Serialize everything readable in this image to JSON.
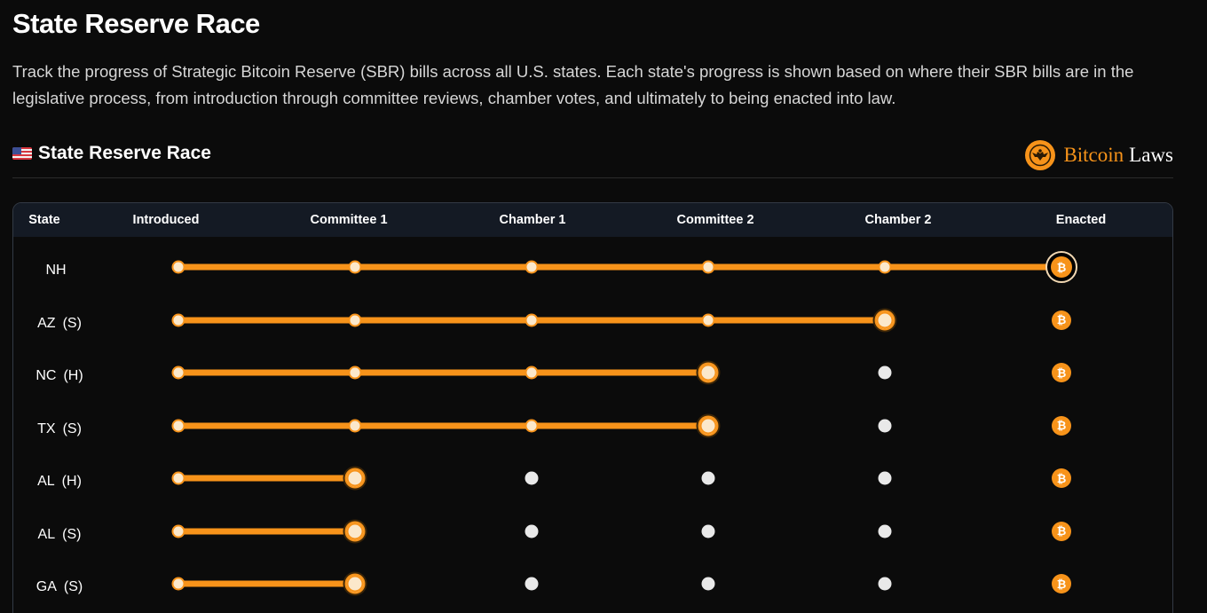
{
  "page": {
    "title": "State Reserve Race",
    "description": "Track the progress of Strategic Bitcoin Reserve (SBR) bills across all U.S. states. Each state's progress is shown based on where their SBR bills are in the legislative process, from introduction through committee reviews, chamber votes, and ultimately to being enacted into law."
  },
  "section": {
    "title": "State Reserve Race",
    "flag_icon": "us-flag-icon",
    "brand": {
      "name_accent": "Bitcoin",
      "name_rest": "Laws",
      "icon": "eagle-seal-icon"
    }
  },
  "table": {
    "headers": [
      "State",
      "Introduced",
      "Committee 1",
      "Chamber 1",
      "Committee 2",
      "Chamber 2",
      "Enacted"
    ],
    "enacted_glyph": "₿",
    "rows": [
      {
        "state": "NH",
        "chamber": "",
        "progress_stage": 5
      },
      {
        "state": "AZ",
        "chamber": "(S)",
        "progress_stage": 4
      },
      {
        "state": "NC",
        "chamber": "(H)",
        "progress_stage": 3
      },
      {
        "state": "TX",
        "chamber": "(S)",
        "progress_stage": 3
      },
      {
        "state": "AL",
        "chamber": "(H)",
        "progress_stage": 1
      },
      {
        "state": "AL",
        "chamber": "(S)",
        "progress_stage": 1
      },
      {
        "state": "GA",
        "chamber": "(S)",
        "progress_stage": 1
      }
    ]
  },
  "colors": {
    "accent": "#f7931a",
    "background": "#0b0b0b",
    "header_background": "#141a24",
    "pending_node": "#e9e9e9"
  }
}
